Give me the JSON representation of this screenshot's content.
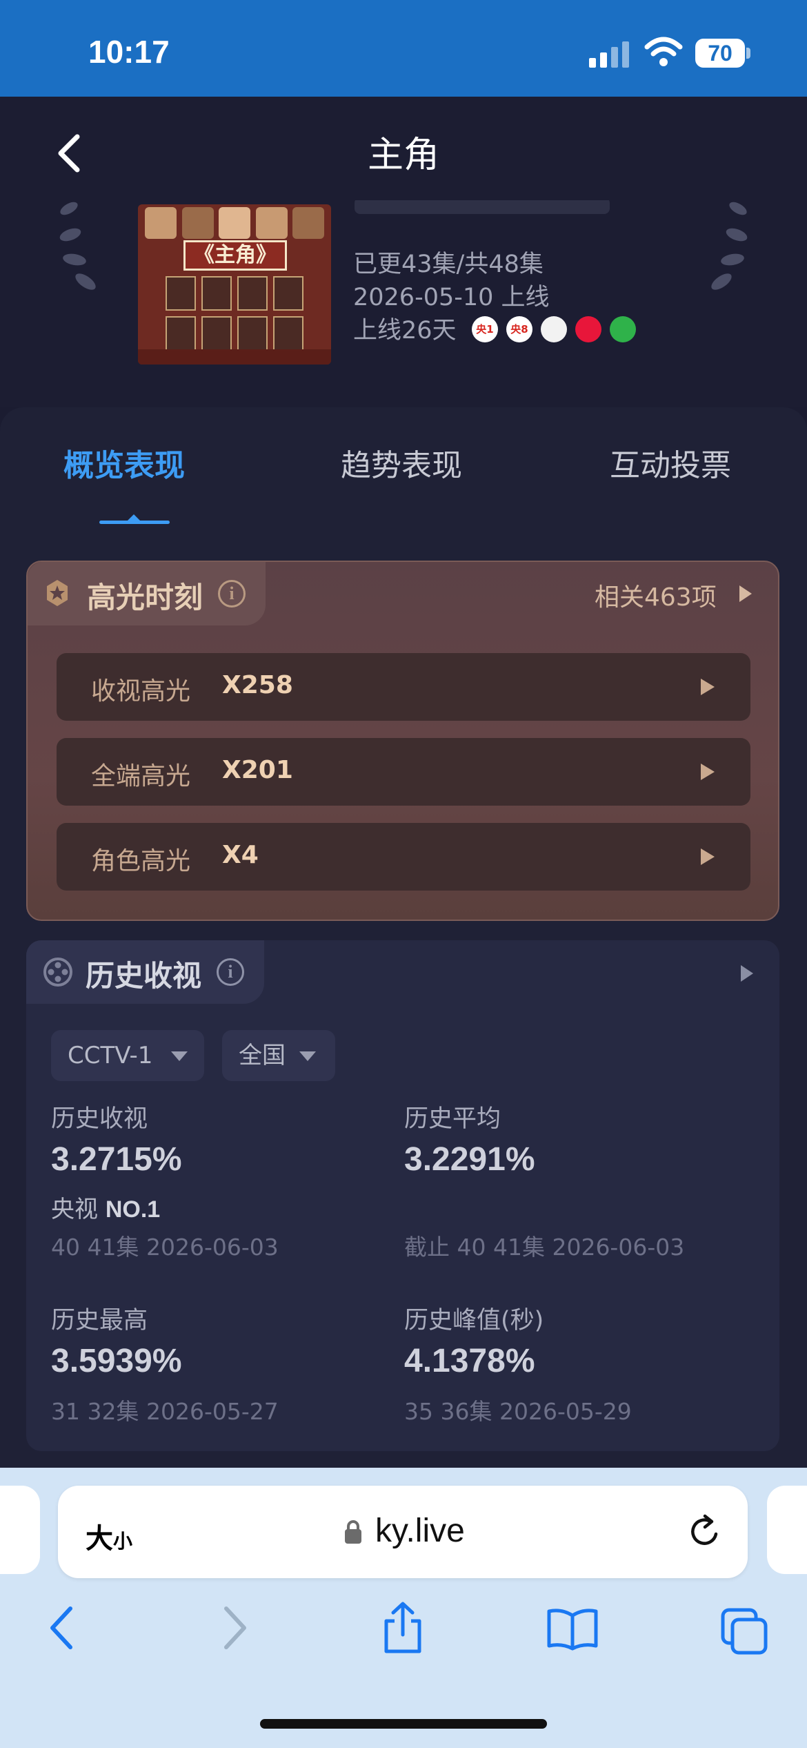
{
  "status_bar": {
    "time": "10:17",
    "battery": "70"
  },
  "header": {
    "title": "主角"
  },
  "drama": {
    "poster_title": "《主角》",
    "episodes": "已更43集/共48集",
    "premiere": "2026-05-10 上线",
    "days_online": "上线26天",
    "platforms": [
      {
        "name": "央1",
        "bg": "#ffffff",
        "fg": "#d8261f"
      },
      {
        "name": "央8",
        "bg": "#ffffff",
        "fg": "#d8261f"
      },
      {
        "name": "",
        "bg": "#f2f2f2",
        "fg": "#d8261f"
      },
      {
        "name": "",
        "bg": "#e8163a",
        "fg": "#ffffff"
      },
      {
        "name": "",
        "bg": "#2fb24a",
        "fg": "#ffffff"
      }
    ]
  },
  "tabs": {
    "overview": "概览表现",
    "trend": "趋势表现",
    "vote": "互动投票"
  },
  "highlights": {
    "title": "高光时刻",
    "related": "相关463项",
    "rows": [
      {
        "label": "收视高光",
        "value": "X258"
      },
      {
        "label": "全端高光",
        "value": "X201"
      },
      {
        "label": "角色高光",
        "value": "X4"
      }
    ]
  },
  "history": {
    "title": "历史收视",
    "channel": "CCTV-1",
    "region": "全国",
    "rating": {
      "label": "历史收视",
      "value": "3.2715%",
      "rank_prefix": "央视",
      "rank": "NO.1",
      "sub": "40 41集  2026-06-03"
    },
    "average": {
      "label": "历史平均",
      "value": "3.2291%",
      "sub": "截止 40 41集  2026-06-03"
    },
    "highest": {
      "label": "历史最高",
      "value": "3.5939%",
      "sub": "31 32集  2026-05-27"
    },
    "peak": {
      "label": "历史峰值(秒)",
      "value": "4.1378%",
      "sub": "35 36集  2026-05-29"
    }
  },
  "browser": {
    "text_size": "大",
    "text_size_small": "小",
    "url": "ky.live"
  },
  "colors": {
    "accent": "#3d9cf4",
    "status_bar": "#1b6fc3",
    "background": "#1b1c31"
  }
}
